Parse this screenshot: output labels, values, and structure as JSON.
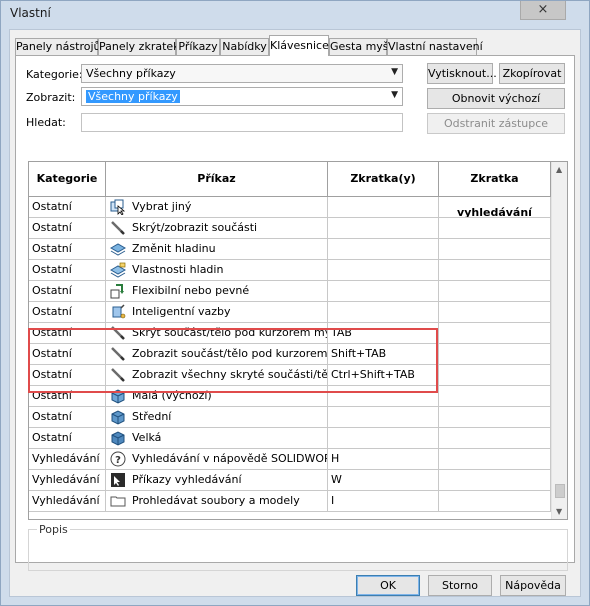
{
  "window": {
    "title": "Vlastní",
    "close_glyph": "×"
  },
  "tabs": [
    {
      "label": "Panely nástrojů"
    },
    {
      "label": "Panely zkratek"
    },
    {
      "label": "Příkazy"
    },
    {
      "label": "Nabídky"
    },
    {
      "label": "Klávesnice",
      "active": true
    },
    {
      "label": "Gesta myši"
    },
    {
      "label": "Vlastní  nastavení"
    }
  ],
  "filters": {
    "category_label": "Kategorie:",
    "category_value": "Všechny příkazy",
    "show_label": "Zobrazit:",
    "show_value": "Všechny příkazy",
    "search_label": "Hledat:",
    "search_value": ""
  },
  "buttons": {
    "print": "Vytisknout...",
    "copy": "Zkopírovat",
    "reset": "Obnovit výchozí",
    "remove": "Odstranit zástupce",
    "ok": "OK",
    "cancel": "Storno",
    "help": "Nápověda"
  },
  "table": {
    "headers": [
      "Kategorie",
      "Příkaz",
      "Zkratka(y)",
      "Zkratka vyhledávání"
    ],
    "rows": [
      {
        "category": "Ostatní",
        "command": "Vybrat jiný",
        "shortcut": "",
        "search": "",
        "icon": "select-other-icon"
      },
      {
        "category": "Ostatní",
        "command": "Skrýt/zobrazit součásti",
        "shortcut": "",
        "search": "",
        "icon": "pencil-icon"
      },
      {
        "category": "Ostatní",
        "command": "Změnit hladinu",
        "shortcut": "",
        "search": "",
        "icon": "layer-icon"
      },
      {
        "category": "Ostatní",
        "command": "Vlastnosti hladin",
        "shortcut": "",
        "search": "",
        "icon": "layer-properties-icon"
      },
      {
        "category": "Ostatní",
        "command": "Flexibilní nebo pevné",
        "shortcut": "",
        "search": "",
        "icon": "flexible-icon"
      },
      {
        "category": "Ostatní",
        "command": "Inteligentní vazby",
        "shortcut": "",
        "search": "",
        "icon": "smart-mates-icon"
      },
      {
        "category": "Ostatní",
        "command": "Skrýt součást/tělo pod kurzorem myši",
        "shortcut": "TAB",
        "search": "",
        "icon": "pencil-icon"
      },
      {
        "category": "Ostatní",
        "command": "Zobrazit součást/tělo pod kurzorem myši",
        "shortcut": "Shift+TAB",
        "search": "",
        "icon": "pencil-icon"
      },
      {
        "category": "Ostatní",
        "command": "Zobrazit všechny skryté součásti/těla",
        "shortcut": "Ctrl+Shift+TAB",
        "search": "",
        "icon": "pencil-icon"
      },
      {
        "category": "Ostatní",
        "command": "Malá (výchozí)",
        "shortcut": "",
        "search": "",
        "icon": "small-cube-icon"
      },
      {
        "category": "Ostatní",
        "command": "Střední",
        "shortcut": "",
        "search": "",
        "icon": "medium-cube-icon"
      },
      {
        "category": "Ostatní",
        "command": "Velká",
        "shortcut": "",
        "search": "",
        "icon": "large-cube-icon"
      },
      {
        "category": "Vyhledávání",
        "command": "Vyhledávání v nápovědě SOLIDWORKS",
        "shortcut": "H",
        "search": "",
        "icon": "help-search-icon"
      },
      {
        "category": "Vyhledávání",
        "command": "Příkazy vyhledávání",
        "shortcut": "W",
        "search": "",
        "icon": "command-search-icon"
      },
      {
        "category": "Vyhledávání",
        "command": "Prohledávat soubory a modely",
        "shortcut": "I",
        "search": "",
        "icon": "folder-icon"
      }
    ]
  },
  "popis": {
    "label": "Popis"
  }
}
